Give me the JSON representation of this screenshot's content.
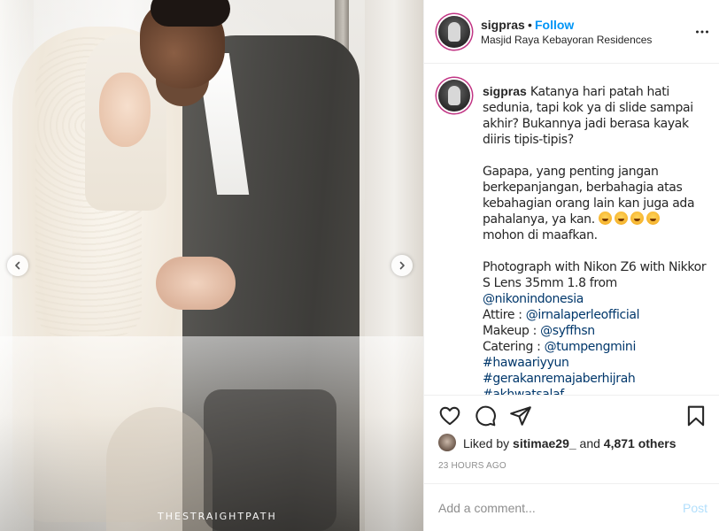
{
  "photo": {
    "watermark": "THESTRAIGHTPATH",
    "prev_icon": "chevron-left-icon",
    "next_icon": "chevron-right-icon"
  },
  "header": {
    "username": "sigpras",
    "separator": "•",
    "follow_label": "Follow",
    "location": "Masjid Raya Kebayoran Residences",
    "more_icon": "more-options-icon"
  },
  "caption": {
    "username": "sigpras",
    "paragraph1": "Katanya hari patah hati sedunia, tapi kok ya di slide sampai akhir? Bukannya jadi berasa kayak diiris tipis-tipis?",
    "paragraph2_text": "Gapapa, yang penting jangan berkepanjangan, berbahagia atas kebahagian orang lain kan juga ada pahalanya, ya kan.",
    "paragraph2_emojis": [
      "squinting-face-emoji",
      "smiling-face-emoji",
      "squinting-face-emoji",
      "smiling-face-emoji"
    ],
    "paragraph2_end": "mohon di maafkan.",
    "photo_line": "Photograph with Nikon Z6 with Nikkor S Lens 35mm 1.8 from",
    "photo_mention": "@nikonindonesia",
    "attire_label": "Attire : ",
    "attire_mention": "@irnalaperleofficial",
    "makeup_label": "Makeup : ",
    "makeup_mention": "@syffhsn",
    "catering_label": "Catering : ",
    "catering_mention": "@tumpengmini",
    "hashtag1": "#hawaariyyun",
    "hashtag2": "#gerakanremajaberhijrah",
    "hashtag3": "#akhwatsalaf"
  },
  "actions": {
    "like_icon": "heart-icon",
    "comment_icon": "comment-bubble-icon",
    "share_icon": "paper-plane-icon",
    "save_icon": "bookmark-icon"
  },
  "likes": {
    "prefix": "Liked by ",
    "user": "sitimae29_",
    "middle": " and ",
    "count": "4,871 others"
  },
  "timestamp": "23 HOURS AGO",
  "add_comment": {
    "placeholder": "Add a comment...",
    "post_label": "Post"
  },
  "colors": {
    "link_blue": "#0095f6",
    "mention_blue": "#00376b",
    "post_disabled": "#b2dffc",
    "muted_gray": "#8e8e8e",
    "text": "#262626"
  }
}
